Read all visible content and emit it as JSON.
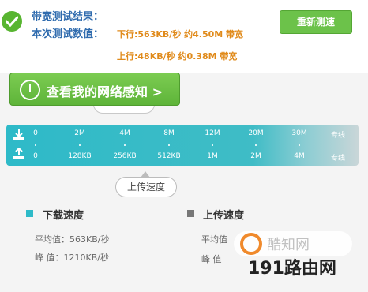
{
  "header": {
    "result_label": "带宽测试结果：",
    "value_label": "本次测试数值：",
    "download_line": "下行:563KB/秒 约4.50M 带宽",
    "upload_line": "上行:48KB/秒 约0.38M 带宽",
    "retest_button": "重新测速"
  },
  "perception": {
    "label": "查看我的网络感知 >"
  },
  "scale": {
    "download_marks": [
      "0",
      "2M",
      "4M",
      "8M",
      "12M",
      "20M",
      "30M",
      "专线"
    ],
    "upload_marks": [
      "0",
      "128KB",
      "256KB",
      "512KB",
      "1M",
      "2M",
      "4M",
      "专线"
    ]
  },
  "pointer": {
    "label": "上传速度"
  },
  "legend": {
    "download": {
      "title": "下载速度",
      "avg": "平均值：563KB/秒",
      "peak": "峰 值：1210KB/秒",
      "color": "#2ebac8"
    },
    "upload": {
      "title": "上传速度",
      "avg": "平均值",
      "peak": "峰 值",
      "color": "#777777"
    }
  },
  "watermark": {
    "logo_text": "酷知网",
    "site_text": "191路由网"
  },
  "icons": {
    "status": "check-icon",
    "timer": "timer-icon",
    "download": "download-icon",
    "upload": "upload-icon"
  }
}
